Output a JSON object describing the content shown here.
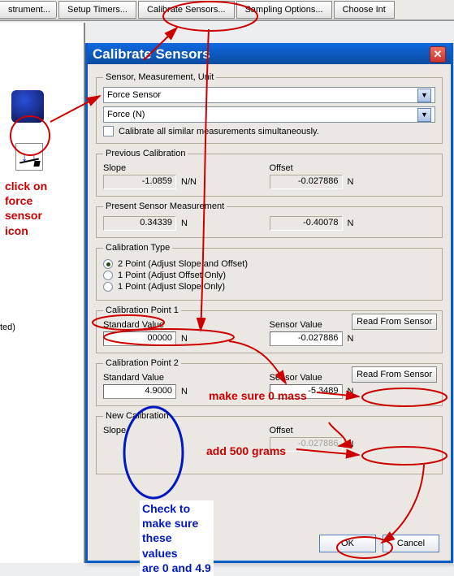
{
  "toolbar": {
    "btn_instrument": "strument...",
    "btn_timers": "Setup Timers...",
    "btn_calibrate": "Calibrate Sensors...",
    "btn_sampling": "Sampling Options...",
    "btn_choose": "Choose Int"
  },
  "leftpanel": {
    "force_icon_arrows": "↓  ↓",
    "ted": "ted)"
  },
  "dialog": {
    "title": "Calibrate Sensors",
    "smu": {
      "legend": "Sensor, Measurement, Unit",
      "sensor": "Force Sensor",
      "measurement": "Force (N)",
      "checkbox_label": "Calibrate all similar measurements simultaneously."
    },
    "prev_cal": {
      "legend": "Previous Calibration",
      "slope_label": "Slope",
      "slope_val": "-1.0859",
      "slope_unit": "N/N",
      "offset_label": "Offset",
      "offset_val": "-0.027886",
      "offset_unit": "N"
    },
    "present": {
      "legend": "Present Sensor Measurement",
      "left_val": "0.34339",
      "left_unit": "N",
      "right_val": "-0.40078",
      "right_unit": "N"
    },
    "ctype": {
      "legend": "Calibration Type",
      "r1": "2 Point (Adjust Slope and Offset)",
      "r2": "1 Point (Adjust Offset Only)",
      "r3": "1 Point (Adjust Slope Only)"
    },
    "cp1": {
      "legend": "Calibration Point 1",
      "std_label": "Standard Value",
      "std_val": "00000",
      "sv_label": "Sensor Value",
      "sv_val": "-0.027886",
      "unit": "N",
      "btn": "Read From Sensor"
    },
    "cp2": {
      "legend": "Calibration Point 2",
      "std_label": "Standard Value",
      "std_val": "4.9000",
      "sv_label": "Sensor Value",
      "sv_val": "-5.3489",
      "unit": "N",
      "btn": "Read From Sensor"
    },
    "newcal": {
      "legend": "New Calibration",
      "slope_label": "Slope",
      "offset_label": "Offset",
      "offset_val": "-0.027886"
    },
    "ok": "OK",
    "cancel": "Cancel"
  },
  "annotations": {
    "click_force": "click on\nforce\nsensor\nicon",
    "zero_mass": "make sure 0 mass",
    "add_500": "add 500 grams",
    "check_vals": "Check to\nmake sure\nthese\nvalues\nare 0 and 4.9"
  }
}
